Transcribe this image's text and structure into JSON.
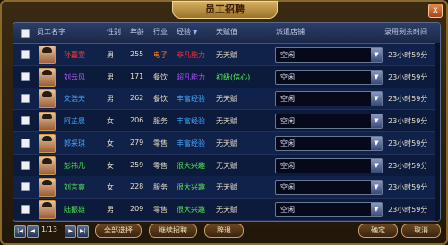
{
  "window": {
    "title": "员工招聘",
    "close_glyph": "x"
  },
  "columns": {
    "name": "员工名字",
    "gender": "性别",
    "age": "年龄",
    "industry": "行业",
    "experience": "经验",
    "trait": "天赋值",
    "store": "派遣店铺",
    "time": "录用剩余时间"
  },
  "rows": [
    {
      "name": "孙嘉雯",
      "name_color": "#ff4040",
      "gender": "男",
      "age": "255",
      "industry": "电子",
      "industry_color": "#ff7a1a",
      "experience": "非凡能力",
      "experience_color": "#ff3030",
      "trait": "无天赋",
      "store": "空闲",
      "time": "23小时59分"
    },
    {
      "name": "刘云风",
      "name_color": "#b060ff",
      "gender": "男",
      "age": "171",
      "industry": "餐饮",
      "industry_color": "#e8e0c8",
      "experience": "超凡能力",
      "experience_color": "#b050ff",
      "trait": "初级(信心)",
      "trait_color": "#50ff50",
      "store": "空闲",
      "time": "23小时59分"
    },
    {
      "name": "文浩天",
      "name_color": "#40a8ff",
      "gender": "男",
      "age": "262",
      "industry": "餐饮",
      "industry_color": "#e8e0c8",
      "experience": "丰富经验",
      "experience_color": "#40a8ff",
      "trait": "无天赋",
      "store": "空闲",
      "time": "23小时59分"
    },
    {
      "name": "阿芷晨",
      "name_color": "#40a8ff",
      "gender": "女",
      "age": "206",
      "industry": "服务",
      "industry_color": "#e8e0c8",
      "experience": "丰富经验",
      "experience_color": "#40a8ff",
      "trait": "无天赋",
      "store": "空闲",
      "time": "23小时59分"
    },
    {
      "name": "郭采琪",
      "name_color": "#40a8ff",
      "gender": "女",
      "age": "279",
      "industry": "零售",
      "industry_color": "#e8e0c8",
      "experience": "丰富经验",
      "experience_color": "#40a8ff",
      "trait": "无天赋",
      "store": "空闲",
      "time": "23小时59分"
    },
    {
      "name": "彭祎凡",
      "name_color": "#50e850",
      "gender": "女",
      "age": "259",
      "industry": "零售",
      "industry_color": "#e8e0c8",
      "experience": "很大兴趣",
      "experience_color": "#50e850",
      "trait": "无天赋",
      "store": "空闲",
      "time": "23小时59分"
    },
    {
      "name": "刘言爽",
      "name_color": "#50e850",
      "gender": "女",
      "age": "228",
      "industry": "服务",
      "industry_color": "#e8e0c8",
      "experience": "很大兴趣",
      "experience_color": "#50e850",
      "trait": "无天赋",
      "store": "空闲",
      "time": "23小时59分"
    },
    {
      "name": "陆振雄",
      "name_color": "#50e850",
      "gender": "男",
      "age": "209",
      "industry": "零售",
      "industry_color": "#e8e0c8",
      "experience": "很大兴趣",
      "experience_color": "#50e850",
      "trait": "无天赋",
      "store": "空闲",
      "time": "23小时59分"
    }
  ],
  "pager": {
    "text": "1/13"
  },
  "buttons": {
    "select_all": "全部选择",
    "continue_hire": "继续招聘",
    "dismiss": "辞退",
    "confirm": "确定",
    "cancel": "取消"
  },
  "colors": {
    "default_text": "#e8e0c8",
    "trait_text": "#e8e0c8"
  }
}
